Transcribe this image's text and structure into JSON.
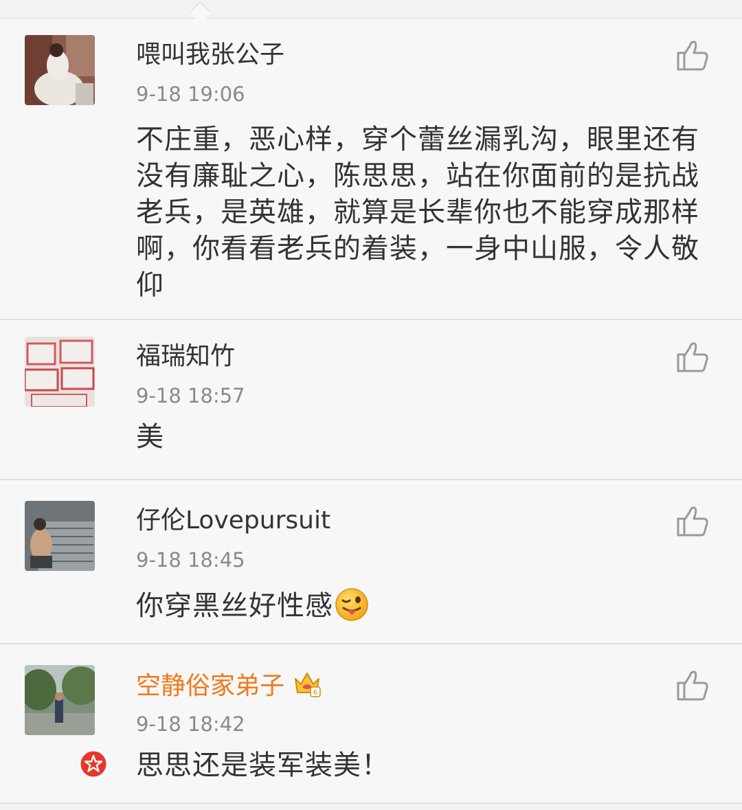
{
  "comments": [
    {
      "name": "喂叫我张公子",
      "time": "9-18 19:06",
      "text": "不庄重，恶心样，穿个蕾丝漏乳沟，眼里还有没有廉耻之心，陈思思，站在你面前的是抗战老兵，是英雄，就算是长辈你也不能穿成那样啊，你看看老兵的着装，一身中山服，令人敬仰",
      "like_icon": "thumbs-up-icon"
    },
    {
      "name": "福瑞知竹",
      "time": "9-18 18:57",
      "text": "美",
      "like_icon": "thumbs-up-icon"
    },
    {
      "name": "仔伦Lovepursuit",
      "time": "9-18 18:45",
      "text": "你穿黑丝好性感",
      "emoji": "tongue-wink-emoji",
      "like_icon": "thumbs-up-icon"
    },
    {
      "name": "空静俗家弟子",
      "time": "9-18 18:42",
      "text": "思思还是装军装美！",
      "name_color": "#f07a1a",
      "badge": "crown-vip-icon",
      "verified": "verified-star-badge",
      "like_icon": "thumbs-up-icon"
    }
  ]
}
